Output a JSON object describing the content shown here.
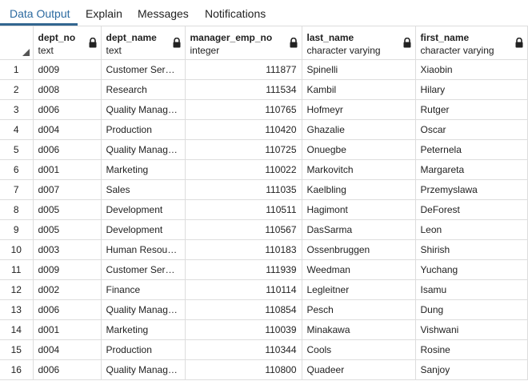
{
  "tabs": [
    {
      "label": "Data Output",
      "active": true
    },
    {
      "label": "Explain",
      "active": false
    },
    {
      "label": "Messages",
      "active": false
    },
    {
      "label": "Notifications",
      "active": false
    }
  ],
  "columns": [
    {
      "name": "dept_no",
      "type": "text"
    },
    {
      "name": "dept_name",
      "type": "text"
    },
    {
      "name": "manager_emp_no",
      "type": "integer"
    },
    {
      "name": "last_name",
      "type": "character varying"
    },
    {
      "name": "first_name",
      "type": "character varying"
    }
  ],
  "rows": [
    {
      "n": "1",
      "dept_no": "d009",
      "dept_name": "Customer Service",
      "manager_emp_no": "111877",
      "last_name": "Spinelli",
      "first_name": "Xiaobin"
    },
    {
      "n": "2",
      "dept_no": "d008",
      "dept_name": "Research",
      "manager_emp_no": "111534",
      "last_name": "Kambil",
      "first_name": "Hilary"
    },
    {
      "n": "3",
      "dept_no": "d006",
      "dept_name": "Quality Management",
      "manager_emp_no": "110765",
      "last_name": "Hofmeyr",
      "first_name": "Rutger"
    },
    {
      "n": "4",
      "dept_no": "d004",
      "dept_name": "Production",
      "manager_emp_no": "110420",
      "last_name": "Ghazalie",
      "first_name": "Oscar"
    },
    {
      "n": "5",
      "dept_no": "d006",
      "dept_name": "Quality Management",
      "manager_emp_no": "110725",
      "last_name": "Onuegbe",
      "first_name": "Peternela"
    },
    {
      "n": "6",
      "dept_no": "d001",
      "dept_name": "Marketing",
      "manager_emp_no": "110022",
      "last_name": "Markovitch",
      "first_name": "Margareta"
    },
    {
      "n": "7",
      "dept_no": "d007",
      "dept_name": "Sales",
      "manager_emp_no": "111035",
      "last_name": "Kaelbling",
      "first_name": "Przemyslawa"
    },
    {
      "n": "8",
      "dept_no": "d005",
      "dept_name": "Development",
      "manager_emp_no": "110511",
      "last_name": "Hagimont",
      "first_name": "DeForest"
    },
    {
      "n": "9",
      "dept_no": "d005",
      "dept_name": "Development",
      "manager_emp_no": "110567",
      "last_name": "DasSarma",
      "first_name": "Leon"
    },
    {
      "n": "10",
      "dept_no": "d003",
      "dept_name": "Human Resources",
      "manager_emp_no": "110183",
      "last_name": "Ossenbruggen",
      "first_name": "Shirish"
    },
    {
      "n": "11",
      "dept_no": "d009",
      "dept_name": "Customer Service",
      "manager_emp_no": "111939",
      "last_name": "Weedman",
      "first_name": "Yuchang"
    },
    {
      "n": "12",
      "dept_no": "d002",
      "dept_name": "Finance",
      "manager_emp_no": "110114",
      "last_name": "Legleitner",
      "first_name": "Isamu"
    },
    {
      "n": "13",
      "dept_no": "d006",
      "dept_name": "Quality Management",
      "manager_emp_no": "110854",
      "last_name": "Pesch",
      "first_name": "Dung"
    },
    {
      "n": "14",
      "dept_no": "d001",
      "dept_name": "Marketing",
      "manager_emp_no": "110039",
      "last_name": "Minakawa",
      "first_name": "Vishwani"
    },
    {
      "n": "15",
      "dept_no": "d004",
      "dept_name": "Production",
      "manager_emp_no": "110344",
      "last_name": "Cools",
      "first_name": "Rosine"
    },
    {
      "n": "16",
      "dept_no": "d006",
      "dept_name": "Quality Management",
      "manager_emp_no": "110800",
      "last_name": "Quadeer",
      "first_name": "Sanjoy"
    }
  ]
}
